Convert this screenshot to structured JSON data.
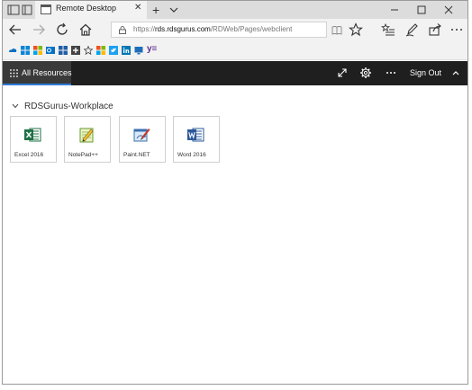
{
  "browser": {
    "tab_title": "Remote Desktop",
    "address": {
      "prefix": "https://",
      "host": "rds.rdsgurus.com",
      "path": "/RDWeb/Pages/webclient"
    }
  },
  "appbar": {
    "all_resources_label": "All Resources",
    "sign_out_label": "Sign Out"
  },
  "content": {
    "group_title": "RDSGurus-Workplace",
    "apps": [
      {
        "label": "Excel 2016",
        "icon": "excel-icon"
      },
      {
        "label": "NotePad++",
        "icon": "notepad-plus-plus-icon"
      },
      {
        "label": "Paint.NET",
        "icon": "paint-net-icon"
      },
      {
        "label": "Word 2016",
        "icon": "word-icon"
      }
    ]
  },
  "colors": {
    "appbar_bg": "#1f1f1f",
    "active_tab_underline": "#2d7ad6",
    "excel_green": "#1e7145",
    "word_blue": "#2b579a"
  }
}
